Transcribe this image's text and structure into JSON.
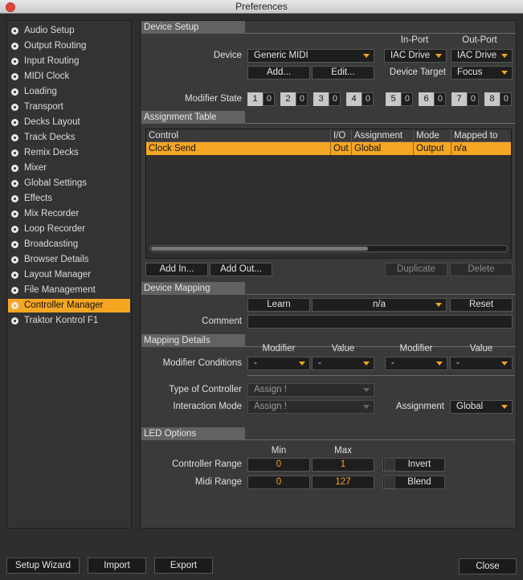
{
  "window": {
    "title": "Preferences"
  },
  "sidebar": {
    "items": [
      {
        "label": "Audio Setup"
      },
      {
        "label": "Output Routing"
      },
      {
        "label": "Input Routing"
      },
      {
        "label": "MIDI Clock"
      },
      {
        "label": "Loading"
      },
      {
        "label": "Transport"
      },
      {
        "label": "Decks Layout"
      },
      {
        "label": "Track Decks"
      },
      {
        "label": "Remix Decks"
      },
      {
        "label": "Mixer"
      },
      {
        "label": "Global Settings"
      },
      {
        "label": "Effects"
      },
      {
        "label": "Mix Recorder"
      },
      {
        "label": "Loop Recorder"
      },
      {
        "label": "Broadcasting"
      },
      {
        "label": "Browser Details"
      },
      {
        "label": "Layout Manager"
      },
      {
        "label": "File Management"
      },
      {
        "label": "Controller Manager",
        "active": true
      },
      {
        "label": "Traktor Kontrol F1"
      }
    ]
  },
  "device_setup": {
    "section_title": "Device Setup",
    "inport_header": "In-Port",
    "outport_header": "Out-Port",
    "device_label": "Device",
    "device_value": "Generic MIDI",
    "inport_value": "IAC Drive",
    "outport_value": "IAC Drive",
    "add_button": "Add...",
    "edit_button": "Edit...",
    "device_target_label": "Device Target",
    "device_target_value": "Focus",
    "modifier_state_label": "Modifier State",
    "modifiers": [
      {
        "n": "1",
        "v": "0"
      },
      {
        "n": "2",
        "v": "0"
      },
      {
        "n": "3",
        "v": "0"
      },
      {
        "n": "4",
        "v": "0"
      },
      {
        "n": "5",
        "v": "0"
      },
      {
        "n": "6",
        "v": "0"
      },
      {
        "n": "7",
        "v": "0"
      },
      {
        "n": "8",
        "v": "0"
      }
    ]
  },
  "assignment_table": {
    "section_title": "Assignment Table",
    "columns": [
      "Control",
      "I/O",
      "Assignment",
      "Mode",
      "Mapped to"
    ],
    "rows": [
      {
        "control": "Clock Send",
        "io": "Out",
        "assignment": "Global",
        "mode": "Output",
        "mapped_to": "n/a"
      }
    ],
    "add_in_button": "Add In...",
    "add_out_button": "Add Out...",
    "duplicate_button": "Duplicate",
    "delete_button": "Delete"
  },
  "device_mapping": {
    "section_title": "Device Mapping",
    "learn_button": "Learn",
    "mapping_value": "n/a",
    "reset_button": "Reset",
    "comment_label": "Comment",
    "comment_value": ""
  },
  "mapping_details": {
    "section_title": "Mapping Details",
    "modifier_header_1": "Modifier",
    "value_header_1": "Value",
    "modifier_header_2": "Modifier",
    "value_header_2": "Value",
    "modifier_conditions_label": "Modifier Conditions",
    "cond1_modifier": "-",
    "cond1_value": "-",
    "cond2_modifier": "-",
    "cond2_value": "-",
    "type_of_controller_label": "Type of Controller",
    "type_of_controller_value": "Assign !",
    "interaction_mode_label": "Interaction Mode",
    "interaction_mode_value": "Assign !",
    "assignment_label": "Assignment",
    "assignment_value": "Global"
  },
  "led_options": {
    "section_title": "LED Options",
    "min_header": "Min",
    "max_header": "Max",
    "controller_range_label": "Controller Range",
    "controller_range_min": "0",
    "controller_range_max": "1",
    "invert_label": "Invert",
    "midi_range_label": "Midi Range",
    "midi_range_min": "0",
    "midi_range_max": "127",
    "blend_label": "Blend"
  },
  "footer": {
    "setup_wizard": "Setup Wizard",
    "import": "Import",
    "export": "Export",
    "close": "Close"
  },
  "colors": {
    "accent": "#f5a623",
    "panel": "#3a3a3a",
    "field": "#1e1e1e"
  }
}
